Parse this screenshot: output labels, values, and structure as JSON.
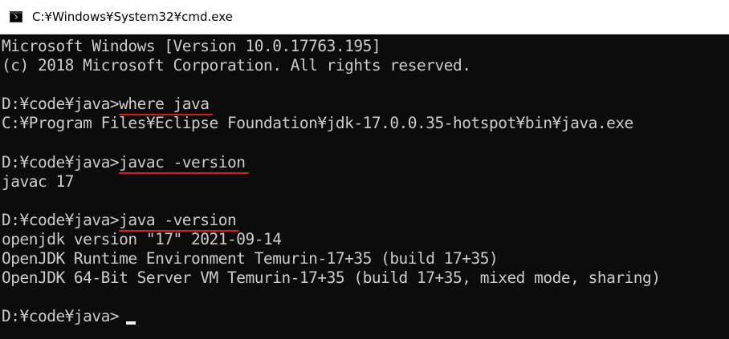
{
  "window": {
    "title": "C:¥Windows¥System32¥cmd.exe",
    "icon": "console-window-icon"
  },
  "console": {
    "colors": {
      "background": "#0c0c0c",
      "text": "#cccccc",
      "highlight_underline": "#d22020"
    },
    "lines": [
      {
        "text": "Microsoft Windows [Version 10.0.17763.195]"
      },
      {
        "text": "(c) 2018 Microsoft Corporation. All rights reserved."
      },
      {
        "text": ""
      },
      {
        "prompt": "D:¥code¥java>",
        "command": "where java",
        "highlighted": true
      },
      {
        "text": "C:¥Program Files¥Eclipse Foundation¥jdk-17.0.0.35-hotspot¥bin¥java.exe"
      },
      {
        "text": ""
      },
      {
        "prompt": "D:¥code¥java>",
        "command": "javac -version",
        "highlighted": true
      },
      {
        "text": "javac 17"
      },
      {
        "text": ""
      },
      {
        "prompt": "D:¥code¥java>",
        "command": "java -version",
        "highlighted": true
      },
      {
        "text": "openjdk version \"17\" 2021-09-14"
      },
      {
        "text": "OpenJDK Runtime Environment Temurin-17+35 (build 17+35)"
      },
      {
        "text": "OpenJDK 64-Bit Server VM Temurin-17+35 (build 17+35, mixed mode, sharing)"
      },
      {
        "text": ""
      },
      {
        "prompt": "D:¥code¥java>",
        "command": ""
      }
    ]
  }
}
